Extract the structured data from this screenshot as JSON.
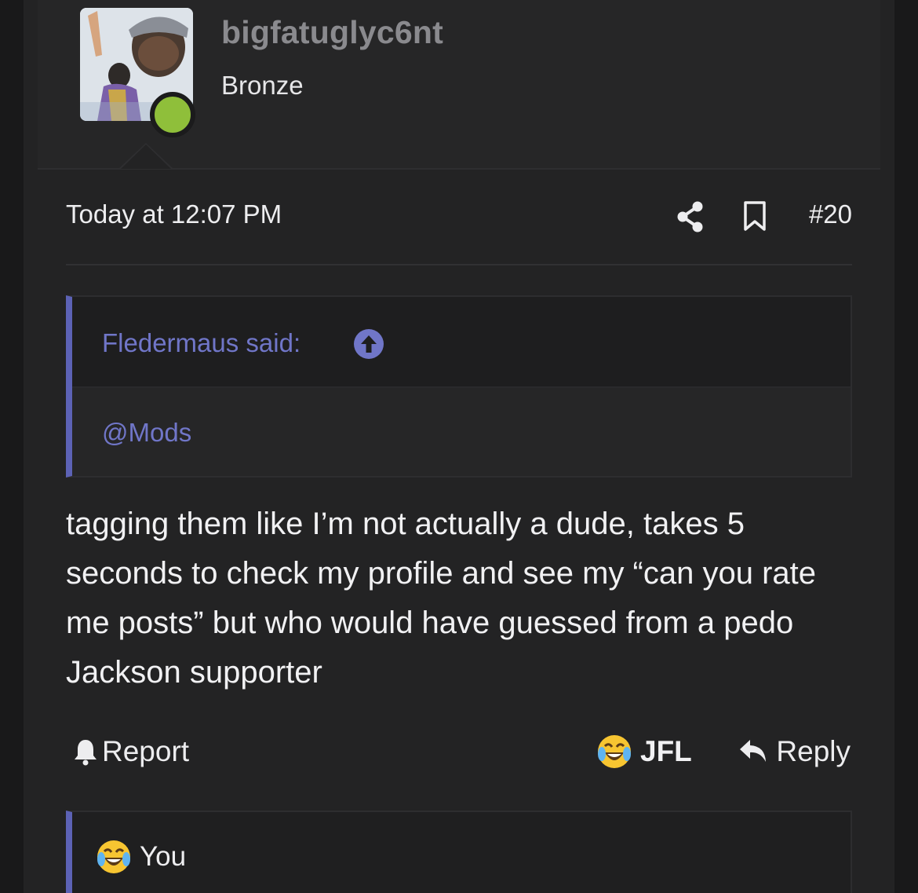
{
  "user": {
    "username": "bigfatuglyc6nt",
    "title": "Bronze",
    "status_color": "#8fbf3a"
  },
  "post": {
    "timestamp": "Today at 12:07 PM",
    "number": "#20",
    "share_icon": "share-icon",
    "bookmark_icon": "bookmark-icon"
  },
  "quote": {
    "author_label": "Fledermaus said:",
    "jump_icon": "arrow-up-circle-icon",
    "text": "@Mods",
    "accent": "#5c62b5"
  },
  "message": {
    "body": "tagging them like I’m not actually a dude, takes 5 seconds to check my profile and see my “can you rate me posts” but who would have guessed from a pedo Jackson supporter"
  },
  "actions": {
    "report_label": "Report",
    "reaction_label": "JFL",
    "reply_label": "Reply"
  },
  "reactions": {
    "summary": "You"
  }
}
